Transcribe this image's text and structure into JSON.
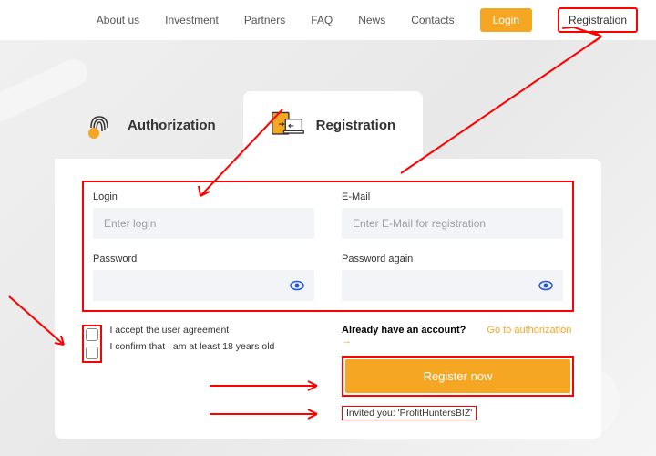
{
  "nav": {
    "items": [
      "About us",
      "Investment",
      "Partners",
      "FAQ",
      "News",
      "Contacts"
    ],
    "login": "Login",
    "registration": "Registration"
  },
  "tabs": {
    "auth": "Authorization",
    "reg": "Registration"
  },
  "fields": {
    "login": {
      "label": "Login",
      "placeholder": "Enter login"
    },
    "email": {
      "label": "E-Mail",
      "placeholder": "Enter E-Mail for registration"
    },
    "password": {
      "label": "Password",
      "placeholder": ""
    },
    "password2": {
      "label": "Password again",
      "placeholder": ""
    }
  },
  "checks": {
    "agreement": "I accept the user agreement",
    "age": "I confirm that I am at least 18 years old"
  },
  "already": {
    "text": "Already have an account?",
    "link": "Go to authorization"
  },
  "submit": "Register now",
  "invited": "Invited you: 'ProfitHuntersBIZ'"
}
